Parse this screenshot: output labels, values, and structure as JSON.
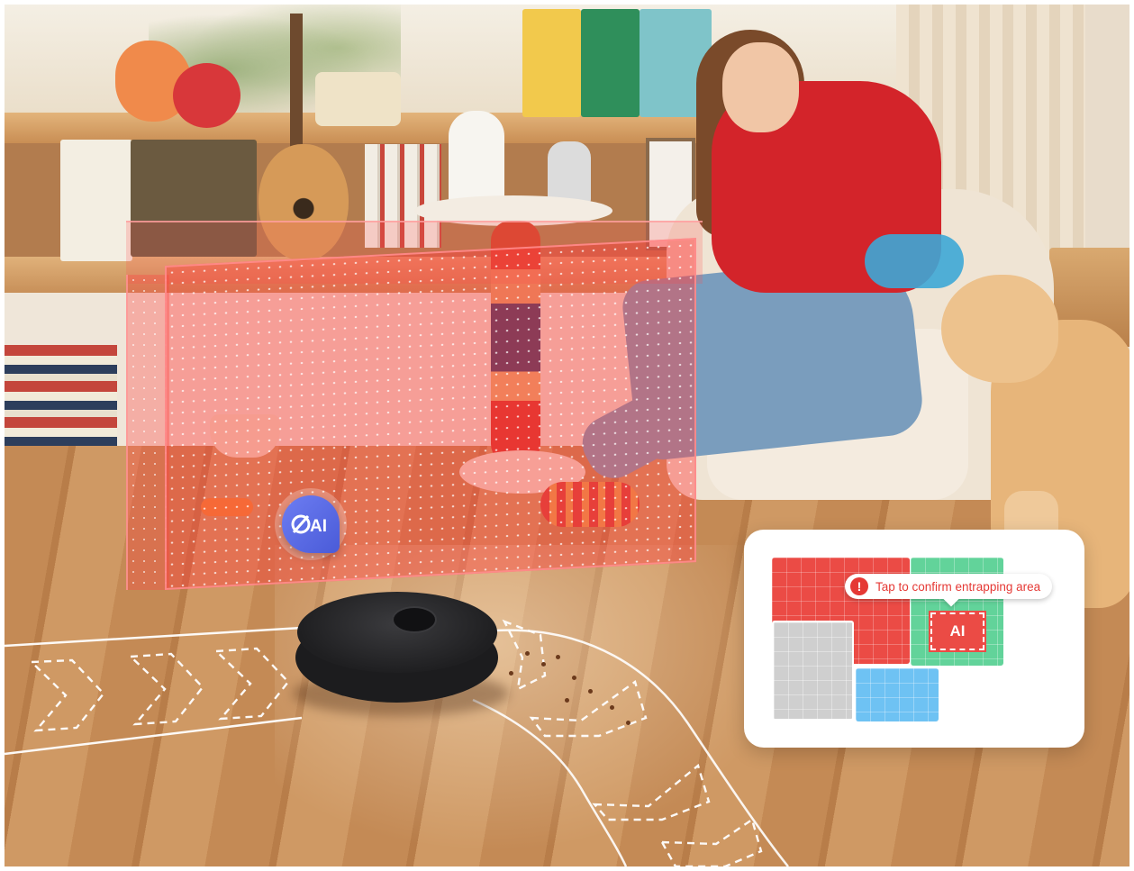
{
  "ai_badge": {
    "label": "AI",
    "icon": "ai-obstacle-icon",
    "color": "#5567e0"
  },
  "map_card": {
    "tooltip": {
      "text": "Tap to confirm entrapping area",
      "icon": "alert-icon",
      "icon_glyph": "!",
      "color": "#e53935"
    },
    "ai_marker_label": "AI",
    "room_colors": {
      "red": "#eb4b45",
      "green": "#62d39a",
      "gray": "#cfcfcf",
      "blue": "#6ec2f3"
    }
  },
  "colors": {
    "ai_zone": "#ff3c3c",
    "path_line": "#ffffff"
  }
}
